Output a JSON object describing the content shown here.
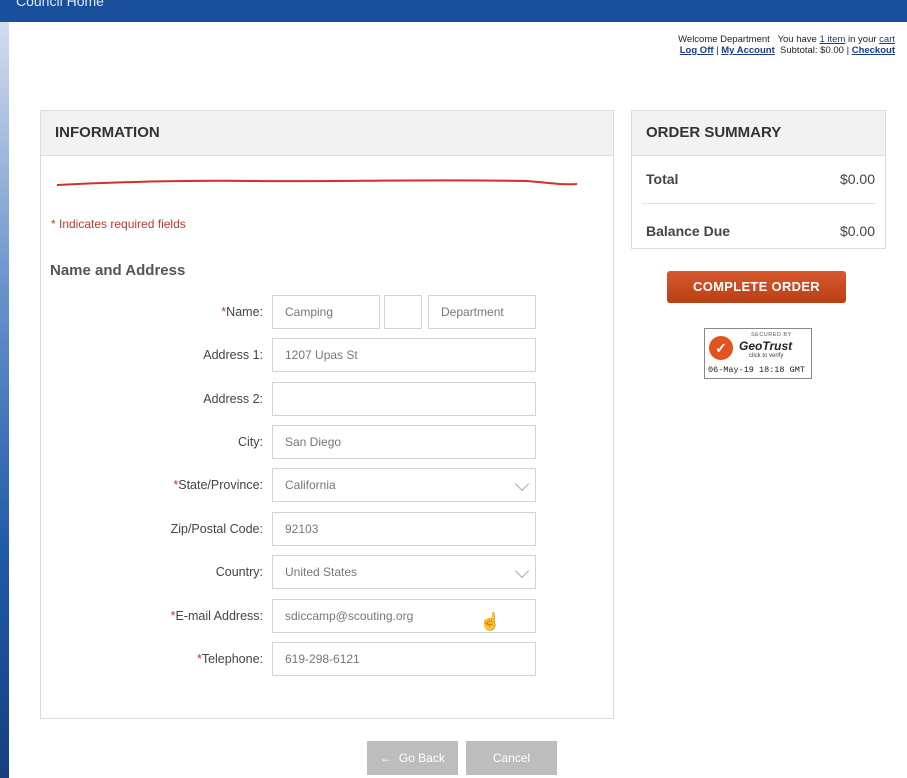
{
  "window": {
    "title": "Council Home"
  },
  "header": {
    "welcome": "Welcome Department",
    "cart_prefix": "You have",
    "cart_items": "1 item",
    "cart_suffix": "in your",
    "cart_link": "cart",
    "log_off": "Log Off",
    "separator": "|",
    "my_account": "My Account",
    "subtotal": "Subtotal: $0.00 |",
    "checkout": "Checkout"
  },
  "information": {
    "heading": "INFORMATION",
    "required_note": "* Indicates required fields",
    "section_title": "Name and Address",
    "fields": {
      "name": {
        "label": "Name:",
        "first": "Camping",
        "middle": "",
        "last": "Department"
      },
      "address1": {
        "label": "Address 1:",
        "value": "1207 Upas St"
      },
      "address2": {
        "label": "Address 2:",
        "value": ""
      },
      "city": {
        "label": "City:",
        "value": "San Diego"
      },
      "state": {
        "label": "State/Province:",
        "value": "California"
      },
      "zip": {
        "label": "Zip/Postal Code:",
        "value": "92103"
      },
      "country": {
        "label": "Country:",
        "value": "United States"
      },
      "email": {
        "label": "E-mail Address:",
        "value": "sdiccamp@scouting.org"
      },
      "telephone": {
        "label": "Telephone:",
        "value": "619-298-6121"
      }
    }
  },
  "summary": {
    "heading": "ORDER SUMMARY",
    "total_label": "Total",
    "total_value": "$0.00",
    "balance_label": "Balance Due",
    "balance_value": "$0.00",
    "complete_button": "COMPLETE ORDER"
  },
  "geotrust": {
    "secured_by": "SECURED BY",
    "brand": "GeoTrust",
    "verify": "click to verify",
    "date": "06-May-19 18:18 GMT"
  },
  "buttons": {
    "go_back": "Go Back",
    "cancel": "Cancel"
  },
  "colors": {
    "topbar": "#1a4f9c",
    "required": "#c0392b",
    "complete_button": "#c8491d",
    "disabled_button": "#bdbdbd"
  }
}
